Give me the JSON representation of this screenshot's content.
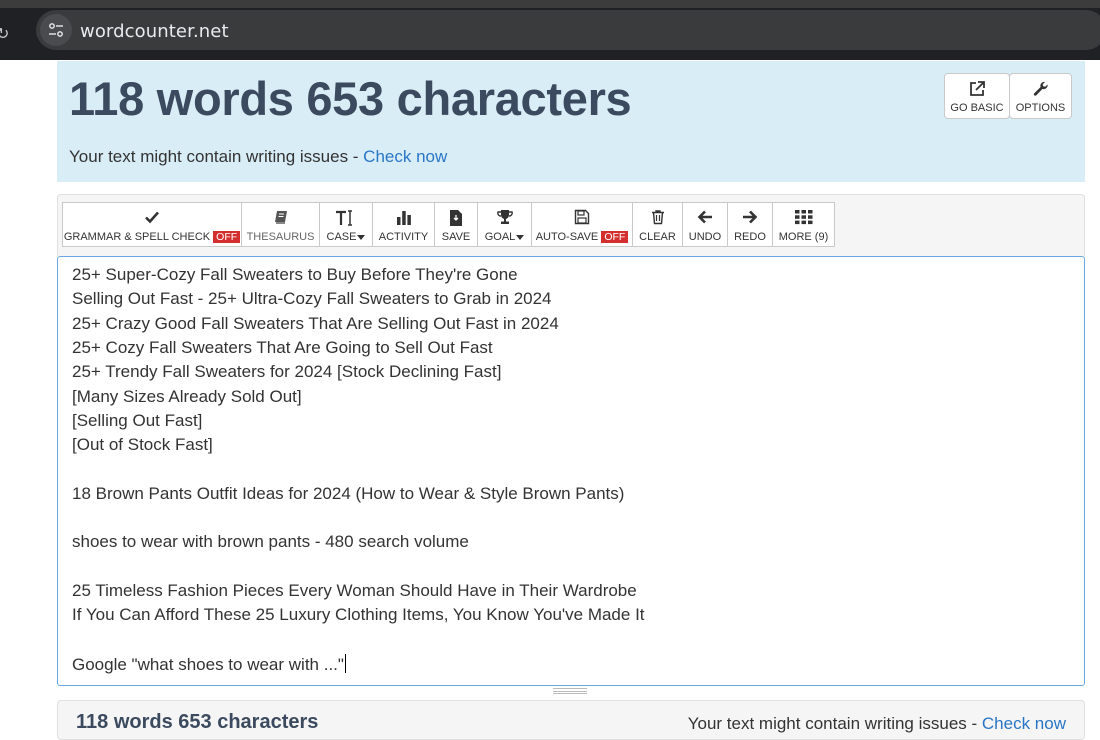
{
  "browser": {
    "url": "wordcounter.net"
  },
  "header": {
    "title": "118 words 653 characters",
    "issue_text": "Your text might contain writing issues - ",
    "issue_link": "Check now",
    "go_basic_label": "GO BASIC",
    "options_label": "OPTIONS"
  },
  "toolbar": {
    "grammar_label": "GRAMMAR & SPELL CHECK",
    "grammar_state": "OFF",
    "thesaurus_label": "THESAURUS",
    "case_label": "CASE",
    "activity_label": "ACTIVITY",
    "save_label": "SAVE",
    "goal_label": "GOAL",
    "autosave_label": "AUTO-SAVE",
    "autosave_state": "OFF",
    "clear_label": "CLEAR",
    "undo_label": "UNDO",
    "redo_label": "REDO",
    "more_label": "MORE (9)"
  },
  "editor": {
    "lines": [
      "25+ Super-Cozy Fall Sweaters to Buy Before They're Gone",
      "Selling Out Fast - 25+ Ultra-Cozy Fall Sweaters to Grab in 2024",
      "25+ Crazy Good Fall Sweaters That Are Selling Out Fast in 2024",
      "25+ Cozy Fall Sweaters That Are Going to Sell Out Fast",
      "25+ Trendy Fall Sweaters for 2024 [Stock Declining Fast]",
      "[Many Sizes Already Sold Out]",
      "[Selling Out Fast]",
      "[Out of Stock Fast]",
      "",
      "18 Brown Pants Outfit Ideas for 2024 (How to Wear & Style Brown Pants)",
      "",
      "shoes to wear with brown pants - 480 search volume",
      "",
      "25 Timeless Fashion Pieces Every Woman Should Have in Their Wardrobe",
      "If You Can Afford These 25 Luxury Clothing Items, You Know You've Made It",
      "",
      "Google \"what shoes to wear with ...\""
    ]
  },
  "footer": {
    "title": "118 words 653 characters",
    "issue_text": "Your text might contain writing issues - ",
    "issue_link": "Check now"
  },
  "colors": {
    "banner_bg": "#d9edf7",
    "title": "#3b4a5e",
    "link": "#2a76c6",
    "off_badge": "#d32f2f",
    "editor_border": "#6aa7e0"
  }
}
